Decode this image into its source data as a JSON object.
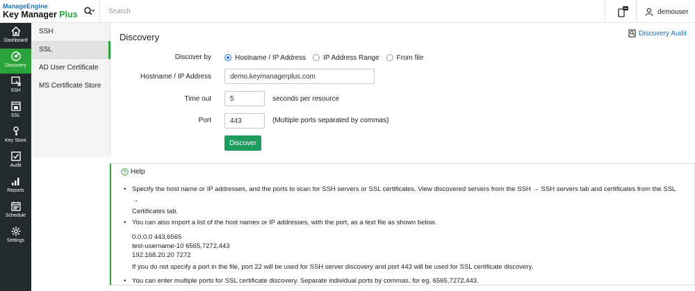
{
  "header": {
    "logo_line1_brand": "Manage",
    "logo_line1_sub": "Engine",
    "logo_line2_main": "Key Manager",
    "logo_line2_accent": "Plus",
    "search_placeholder": "Search",
    "username": "demouser"
  },
  "nav": {
    "items": [
      {
        "label": "Dashboard",
        "icon": "home-icon"
      },
      {
        "label": "Discovery",
        "icon": "discovery-icon",
        "active": true
      },
      {
        "label": "SSH",
        "icon": "ssh-icon"
      },
      {
        "label": "SSL",
        "icon": "ssl-icon"
      },
      {
        "label": "Key Store",
        "icon": "key-icon"
      },
      {
        "label": "Audit",
        "icon": "audit-icon"
      },
      {
        "label": "Reports",
        "icon": "reports-icon"
      },
      {
        "label": "Schedule",
        "icon": "calendar-icon"
      },
      {
        "label": "Settings",
        "icon": "settings-icon"
      }
    ]
  },
  "subnav": {
    "items": [
      {
        "label": "SSH"
      },
      {
        "label": "SSL",
        "active": true
      },
      {
        "label": "AD User Certificate"
      },
      {
        "label": "MS Certificate Store"
      }
    ]
  },
  "page": {
    "title": "Discovery",
    "audit_link": "Discovery Audit"
  },
  "form": {
    "discover_by_label": "Discover by",
    "options": [
      "Hostname / IP Address",
      "IP Address Range",
      "From file"
    ],
    "selected_option": "Hostname / IP Address",
    "hostname_label": "Hostname / IP Address",
    "hostname_value": "demo.keymanagerplus.com",
    "timeout_label": "Time out",
    "timeout_value": "5",
    "timeout_hint": "seconds per resource",
    "port_label": "Port",
    "port_value": "443",
    "port_hint": "(Multiple ports separated by commas)",
    "discover_button": "Discover"
  },
  "help": {
    "title": "Help",
    "bullet1_line1": "Specify the host name or IP addresses, and the ports to scan for SSH servers or SSL certificates. View discovered servers from the SSH → SSH servers tab and certificates from the SSL →",
    "bullet1_line2": "Certificates tab.",
    "bullet2": "You can also import a list of the host names or IP addresses, with the port, as a text file as shown below.",
    "examples": [
      "0.0.0.0 443,6565",
      "test-username-10 6565,7272,443",
      "192.168.20.20 7272"
    ],
    "note": "If you do not specify a port in the file, port 22 will be used for SSH server discovery and port 443 will be used for SSL certificate discovery.",
    "bullet3": "You can enter multiple ports for SSL certificate discovery. Separate individual ports by commas, for eg. 6565,7272,443."
  },
  "colors": {
    "accent_green": "#2aa33a",
    "nav_bg": "#222a2e",
    "link_blue": "#1a6fb5",
    "button_green": "#1e9b5f",
    "radio_blue": "#1a73e8"
  }
}
